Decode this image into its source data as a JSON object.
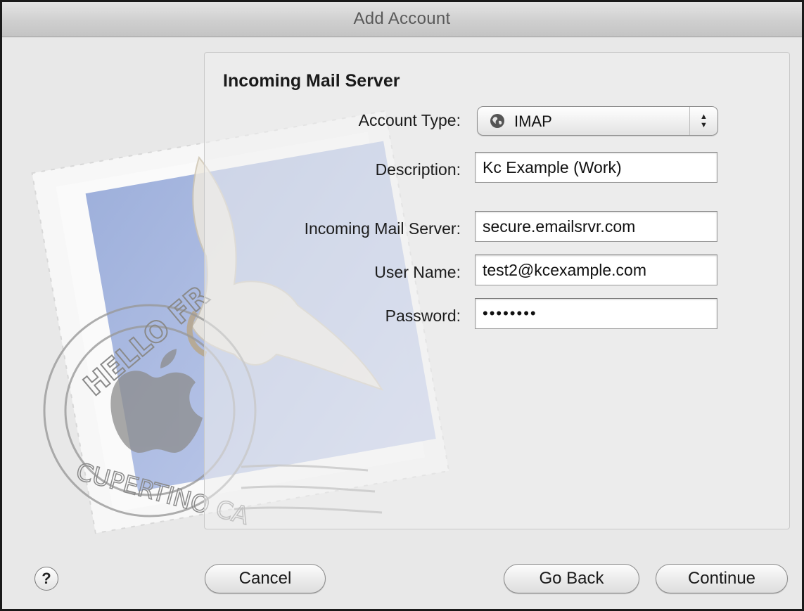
{
  "window": {
    "title": "Add Account"
  },
  "form": {
    "heading": "Incoming Mail Server",
    "account_type": {
      "label": "Account Type:",
      "value": "IMAP"
    },
    "description": {
      "label": "Description:",
      "value": "Kc Example (Work)"
    },
    "incoming_server": {
      "label": "Incoming Mail Server:",
      "value": "secure.emailsrvr.com"
    },
    "user_name": {
      "label": "User Name:",
      "value": "test2@kcexample.com"
    },
    "password": {
      "label": "Password:",
      "value": "••••••••"
    }
  },
  "stamp": {
    "top_text": "HELLO FR",
    "bottom_text": "CUPERTINO CA"
  },
  "buttons": {
    "help": "?",
    "cancel": "Cancel",
    "go_back": "Go Back",
    "continue": "Continue"
  }
}
